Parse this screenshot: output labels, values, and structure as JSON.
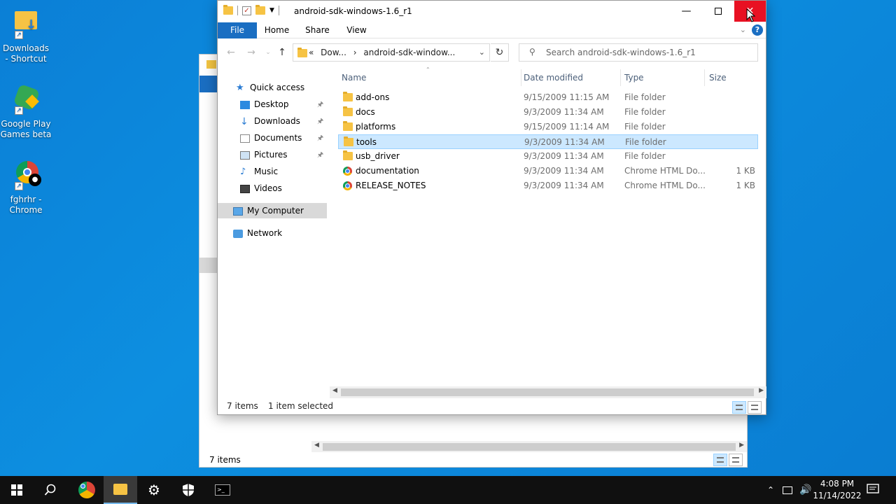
{
  "desktop": {
    "icons": [
      {
        "label": "Downloads - Shortcut",
        "icon": "downloads-folder-icon"
      },
      {
        "label": "Google Play Games beta",
        "icon": "google-play-games-icon"
      },
      {
        "label": "fghrhr - Chrome",
        "icon": "chrome-profile-icon"
      }
    ]
  },
  "back_window": {
    "status_items": "7 items"
  },
  "window": {
    "title": "android-sdk-windows-1.6_r1",
    "ribbon_tabs": [
      "File",
      "Home",
      "Share",
      "View"
    ],
    "address": {
      "crumb_overflow": "«",
      "crumb_1": "Dow...",
      "crumb_2": "android-sdk-window...",
      "separator": "›"
    },
    "search_placeholder": "Search android-sdk-windows-1.6_r1",
    "nav_pane": [
      {
        "label": "Quick access",
        "icon": "star-icon",
        "pinned": false
      },
      {
        "label": "Desktop",
        "icon": "desktop-icon",
        "pinned": true
      },
      {
        "label": "Downloads",
        "icon": "download-arrow-icon",
        "pinned": true
      },
      {
        "label": "Documents",
        "icon": "documents-icon",
        "pinned": true
      },
      {
        "label": "Pictures",
        "icon": "pictures-icon",
        "pinned": true
      },
      {
        "label": "Music",
        "icon": "music-icon",
        "pinned": false
      },
      {
        "label": "Videos",
        "icon": "videos-icon",
        "pinned": false
      },
      {
        "label": "My Computer",
        "icon": "computer-icon",
        "pinned": false
      },
      {
        "label": "Network",
        "icon": "network-icon",
        "pinned": false
      }
    ],
    "columns": {
      "name": "Name",
      "date": "Date modified",
      "type": "Type",
      "size": "Size"
    },
    "files": [
      {
        "name": "add-ons",
        "date": "9/15/2009 11:15 AM",
        "type": "File folder",
        "size": "",
        "icon": "folder-icon"
      },
      {
        "name": "docs",
        "date": "9/3/2009 11:34 AM",
        "type": "File folder",
        "size": "",
        "icon": "folder-icon"
      },
      {
        "name": "platforms",
        "date": "9/15/2009 11:14 AM",
        "type": "File folder",
        "size": "",
        "icon": "folder-icon"
      },
      {
        "name": "tools",
        "date": "9/3/2009 11:34 AM",
        "type": "File folder",
        "size": "",
        "icon": "folder-icon",
        "selected": true
      },
      {
        "name": "usb_driver",
        "date": "9/3/2009 11:34 AM",
        "type": "File folder",
        "size": "",
        "icon": "folder-icon"
      },
      {
        "name": "documentation",
        "date": "9/3/2009 11:34 AM",
        "type": "Chrome HTML Do...",
        "size": "1 KB",
        "icon": "chrome-html-icon"
      },
      {
        "name": "RELEASE_NOTES",
        "date": "9/3/2009 11:34 AM",
        "type": "Chrome HTML Do...",
        "size": "1 KB",
        "icon": "chrome-html-icon"
      }
    ],
    "status": {
      "count": "7 items",
      "selection": "1 item selected"
    }
  },
  "taskbar": {
    "time": "4:08 PM",
    "date": "11/14/2022"
  },
  "colors": {
    "desktop": "#0b7fd6",
    "accent": "#1a6ec2",
    "close_red": "#e81123",
    "selection": "#cce8ff"
  }
}
